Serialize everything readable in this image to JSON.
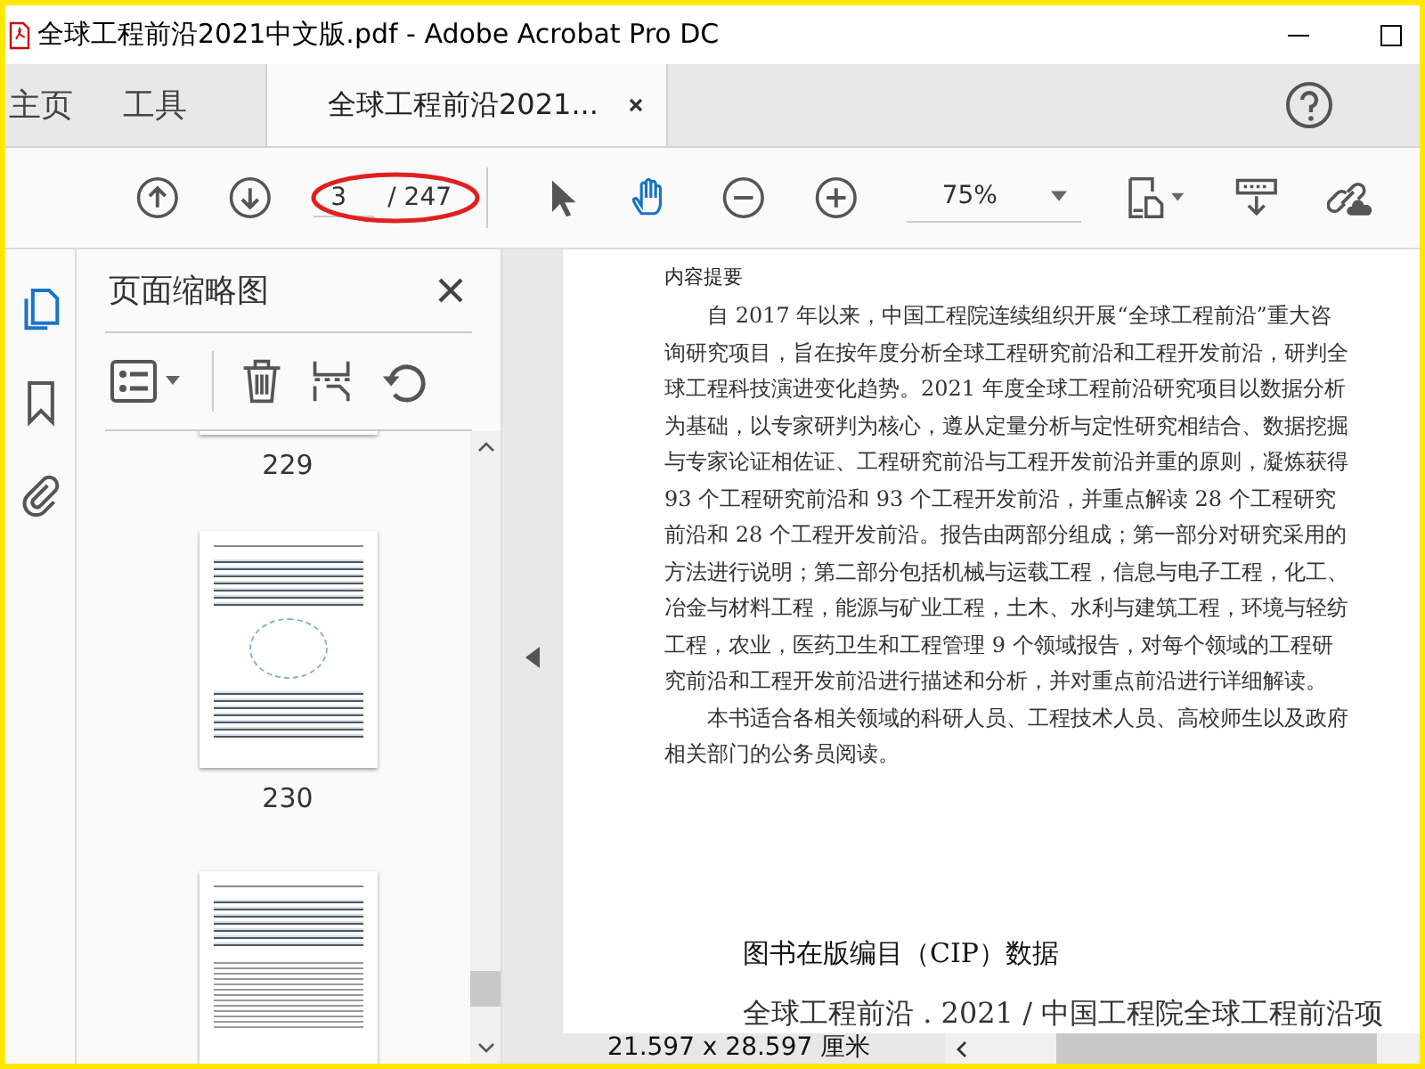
{
  "window": {
    "title": "全球工程前沿2021中文版.pdf - Adobe Acrobat Pro DC"
  },
  "tabs": [
    {
      "label": "主页",
      "selected": false,
      "kind": "nav"
    },
    {
      "label": "工具",
      "selected": false,
      "kind": "nav"
    },
    {
      "label": "全球工程前沿2021...",
      "selected": true,
      "kind": "doc"
    }
  ],
  "toolbar": {
    "page_number": "3",
    "page_total": "/ 247",
    "zoom": "75%"
  },
  "nav_rail": [
    {
      "kind": "pages",
      "selected": true
    },
    {
      "kind": "bookmarks",
      "selected": false
    },
    {
      "kind": "attachments",
      "selected": false
    }
  ],
  "thumbnail_panel": {
    "title": "页面缩略图",
    "pages": [
      {
        "kind": "tail",
        "number": "229"
      },
      {
        "kind": "full",
        "number": "230"
      },
      {
        "kind": "top"
      }
    ]
  },
  "document": {
    "heading": "内容提要",
    "paragraphs": [
      "自 2017 年以来，中国工程院连续组织开展“全球工程前沿”重大咨询研究项目，旨在按年度分析全球工程研究前沿和工程开发前沿，研判全球工程科技演进变化趋势。2021 年度全球工程前沿研究项目以数据分析为基础，以专家研判为核心，遵从定量分析与定性研究相结合、数据挖掘与专家论证相佐证、工程研究前沿与工程开发前沿并重的原则，凝炼获得 93 个工程研究前沿和 93 个工程开发前沿，并重点解读 28 个工程研究前沿和 28 个工程开发前沿。报告由两部分组成；第一部分对研究采用的方法进行说明；第二部分包括机械与运载工程，信息与电子工程，化工、冶金与材料工程，能源与矿业工程，土木、水利与建筑工程，环境与轻纺工程，农业，医药卫生和工程管理 9 个领域报告，对每个领域的工程研究前沿和工程开发前沿进行描述和分析，并对重点前沿进行详细解读。",
      "本书适合各相关领域的科研人员、工程技术人员、高校师生以及政府相关部门的公务员阅读。"
    ],
    "cip_heading": "图书在版编目（CIP）数据",
    "cip_text": "全球工程前沿 . 2021 / 中国工程院全球工程前沿项"
  },
  "status_bar": {
    "page_size": "21.597 x 28.597 厘米"
  }
}
